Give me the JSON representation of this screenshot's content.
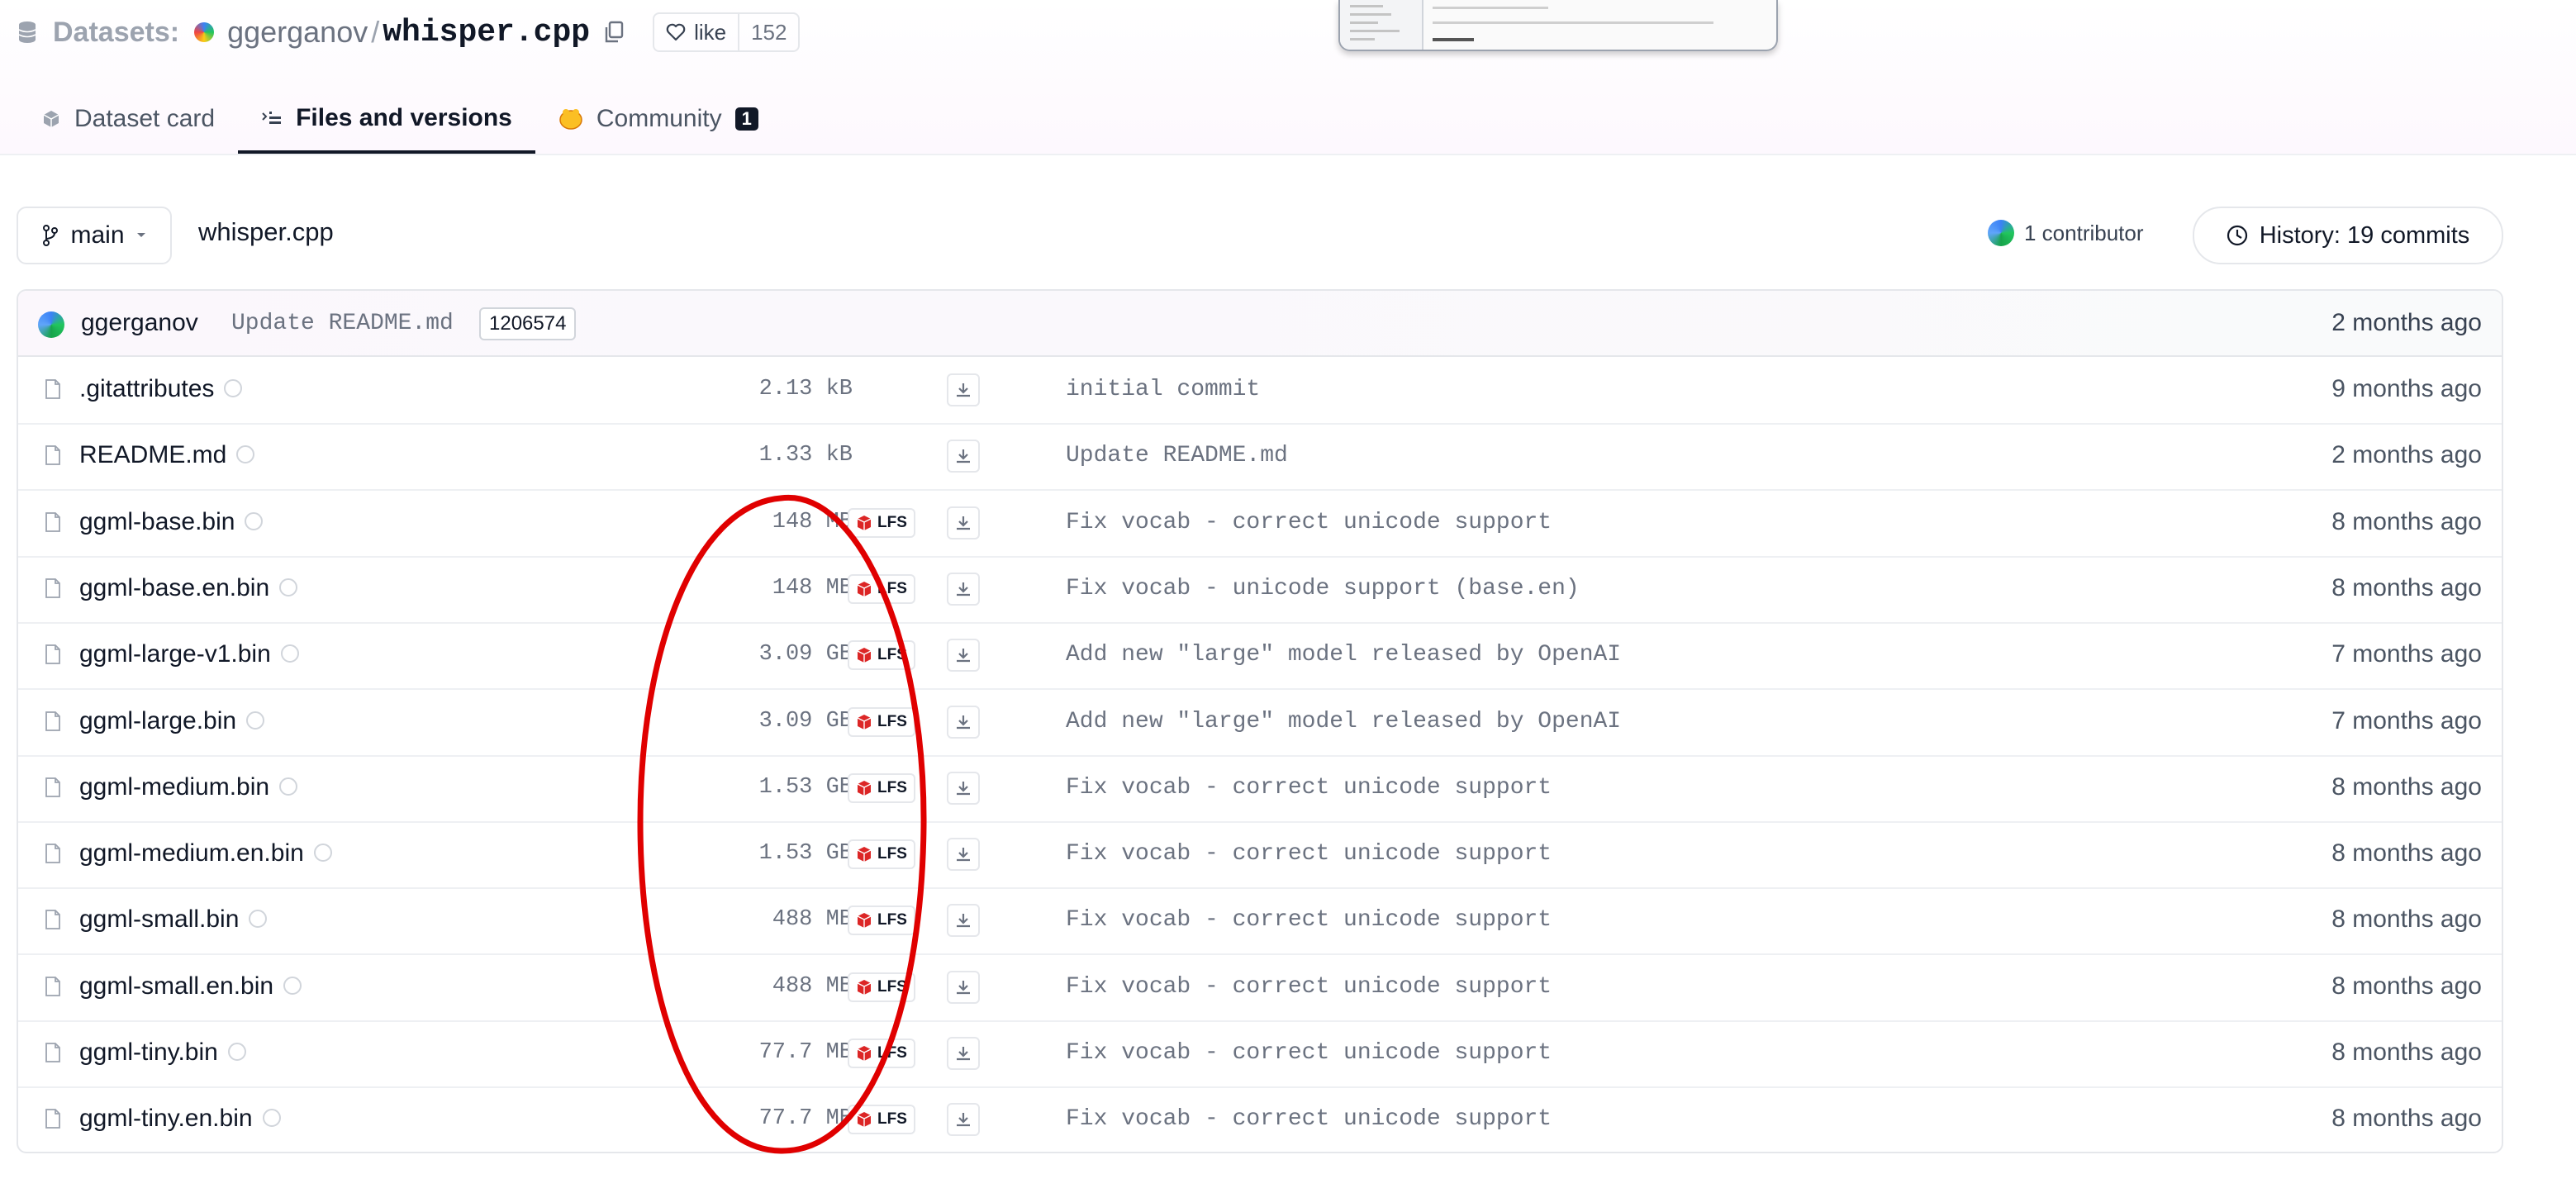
{
  "header": {
    "datasets_label": "Datasets:",
    "owner": "ggerganov",
    "separator": "/",
    "repo": "whisper.cpp",
    "like_label": "like",
    "like_count": "152",
    "tabs": [
      {
        "label": "Dataset card",
        "icon": "card-icon"
      },
      {
        "label": "Files and versions",
        "icon": "files-icon",
        "active": true
      },
      {
        "label": "Community",
        "icon": "community-icon",
        "badge": "1"
      }
    ]
  },
  "toolbar": {
    "branch": "main",
    "path": "whisper.cpp",
    "contributors": "1 contributor",
    "history": "History: 19 commits"
  },
  "last_commit": {
    "author": "ggerganov",
    "message": "Update README.md",
    "hash": "1206574",
    "time": "2 months ago"
  },
  "files": [
    {
      "name": ".gitattributes",
      "size": "2.13 kB",
      "lfs": false,
      "message": "initial commit",
      "time": "9 months ago"
    },
    {
      "name": "README.md",
      "size": "1.33 kB",
      "lfs": false,
      "message": "Update README.md",
      "time": "2 months ago"
    },
    {
      "name": "ggml-base.bin",
      "size": "148 MB",
      "lfs": true,
      "message": "Fix vocab - correct unicode support",
      "time": "8 months ago"
    },
    {
      "name": "ggml-base.en.bin",
      "size": "148 MB",
      "lfs": true,
      "message": "Fix vocab - unicode support (base.en)",
      "time": "8 months ago"
    },
    {
      "name": "ggml-large-v1.bin",
      "size": "3.09 GB",
      "lfs": true,
      "message": "Add new \"large\" model released by OpenAI",
      "time": "7 months ago"
    },
    {
      "name": "ggml-large.bin",
      "size": "3.09 GB",
      "lfs": true,
      "message": "Add new \"large\" model released by OpenAI",
      "time": "7 months ago"
    },
    {
      "name": "ggml-medium.bin",
      "size": "1.53 GB",
      "lfs": true,
      "message": "Fix vocab - correct unicode support",
      "time": "8 months ago"
    },
    {
      "name": "ggml-medium.en.bin",
      "size": "1.53 GB",
      "lfs": true,
      "message": "Fix vocab - correct unicode support",
      "time": "8 months ago"
    },
    {
      "name": "ggml-small.bin",
      "size": "488 MB",
      "lfs": true,
      "message": "Fix vocab - correct unicode support",
      "time": "8 months ago"
    },
    {
      "name": "ggml-small.en.bin",
      "size": "488 MB",
      "lfs": true,
      "message": "Fix vocab - correct unicode support",
      "time": "8 months ago"
    },
    {
      "name": "ggml-tiny.bin",
      "size": "77.7 MB",
      "lfs": true,
      "message": "Fix vocab - correct unicode support",
      "time": "8 months ago"
    },
    {
      "name": "ggml-tiny.en.bin",
      "size": "77.7 MB",
      "lfs": true,
      "message": "Fix vocab - correct unicode support",
      "time": "8 months ago"
    }
  ],
  "lfs_label": "LFS",
  "colors": {
    "annotation": "#e00000",
    "lfs_icon": "#dc2626",
    "accent": "#111827"
  }
}
